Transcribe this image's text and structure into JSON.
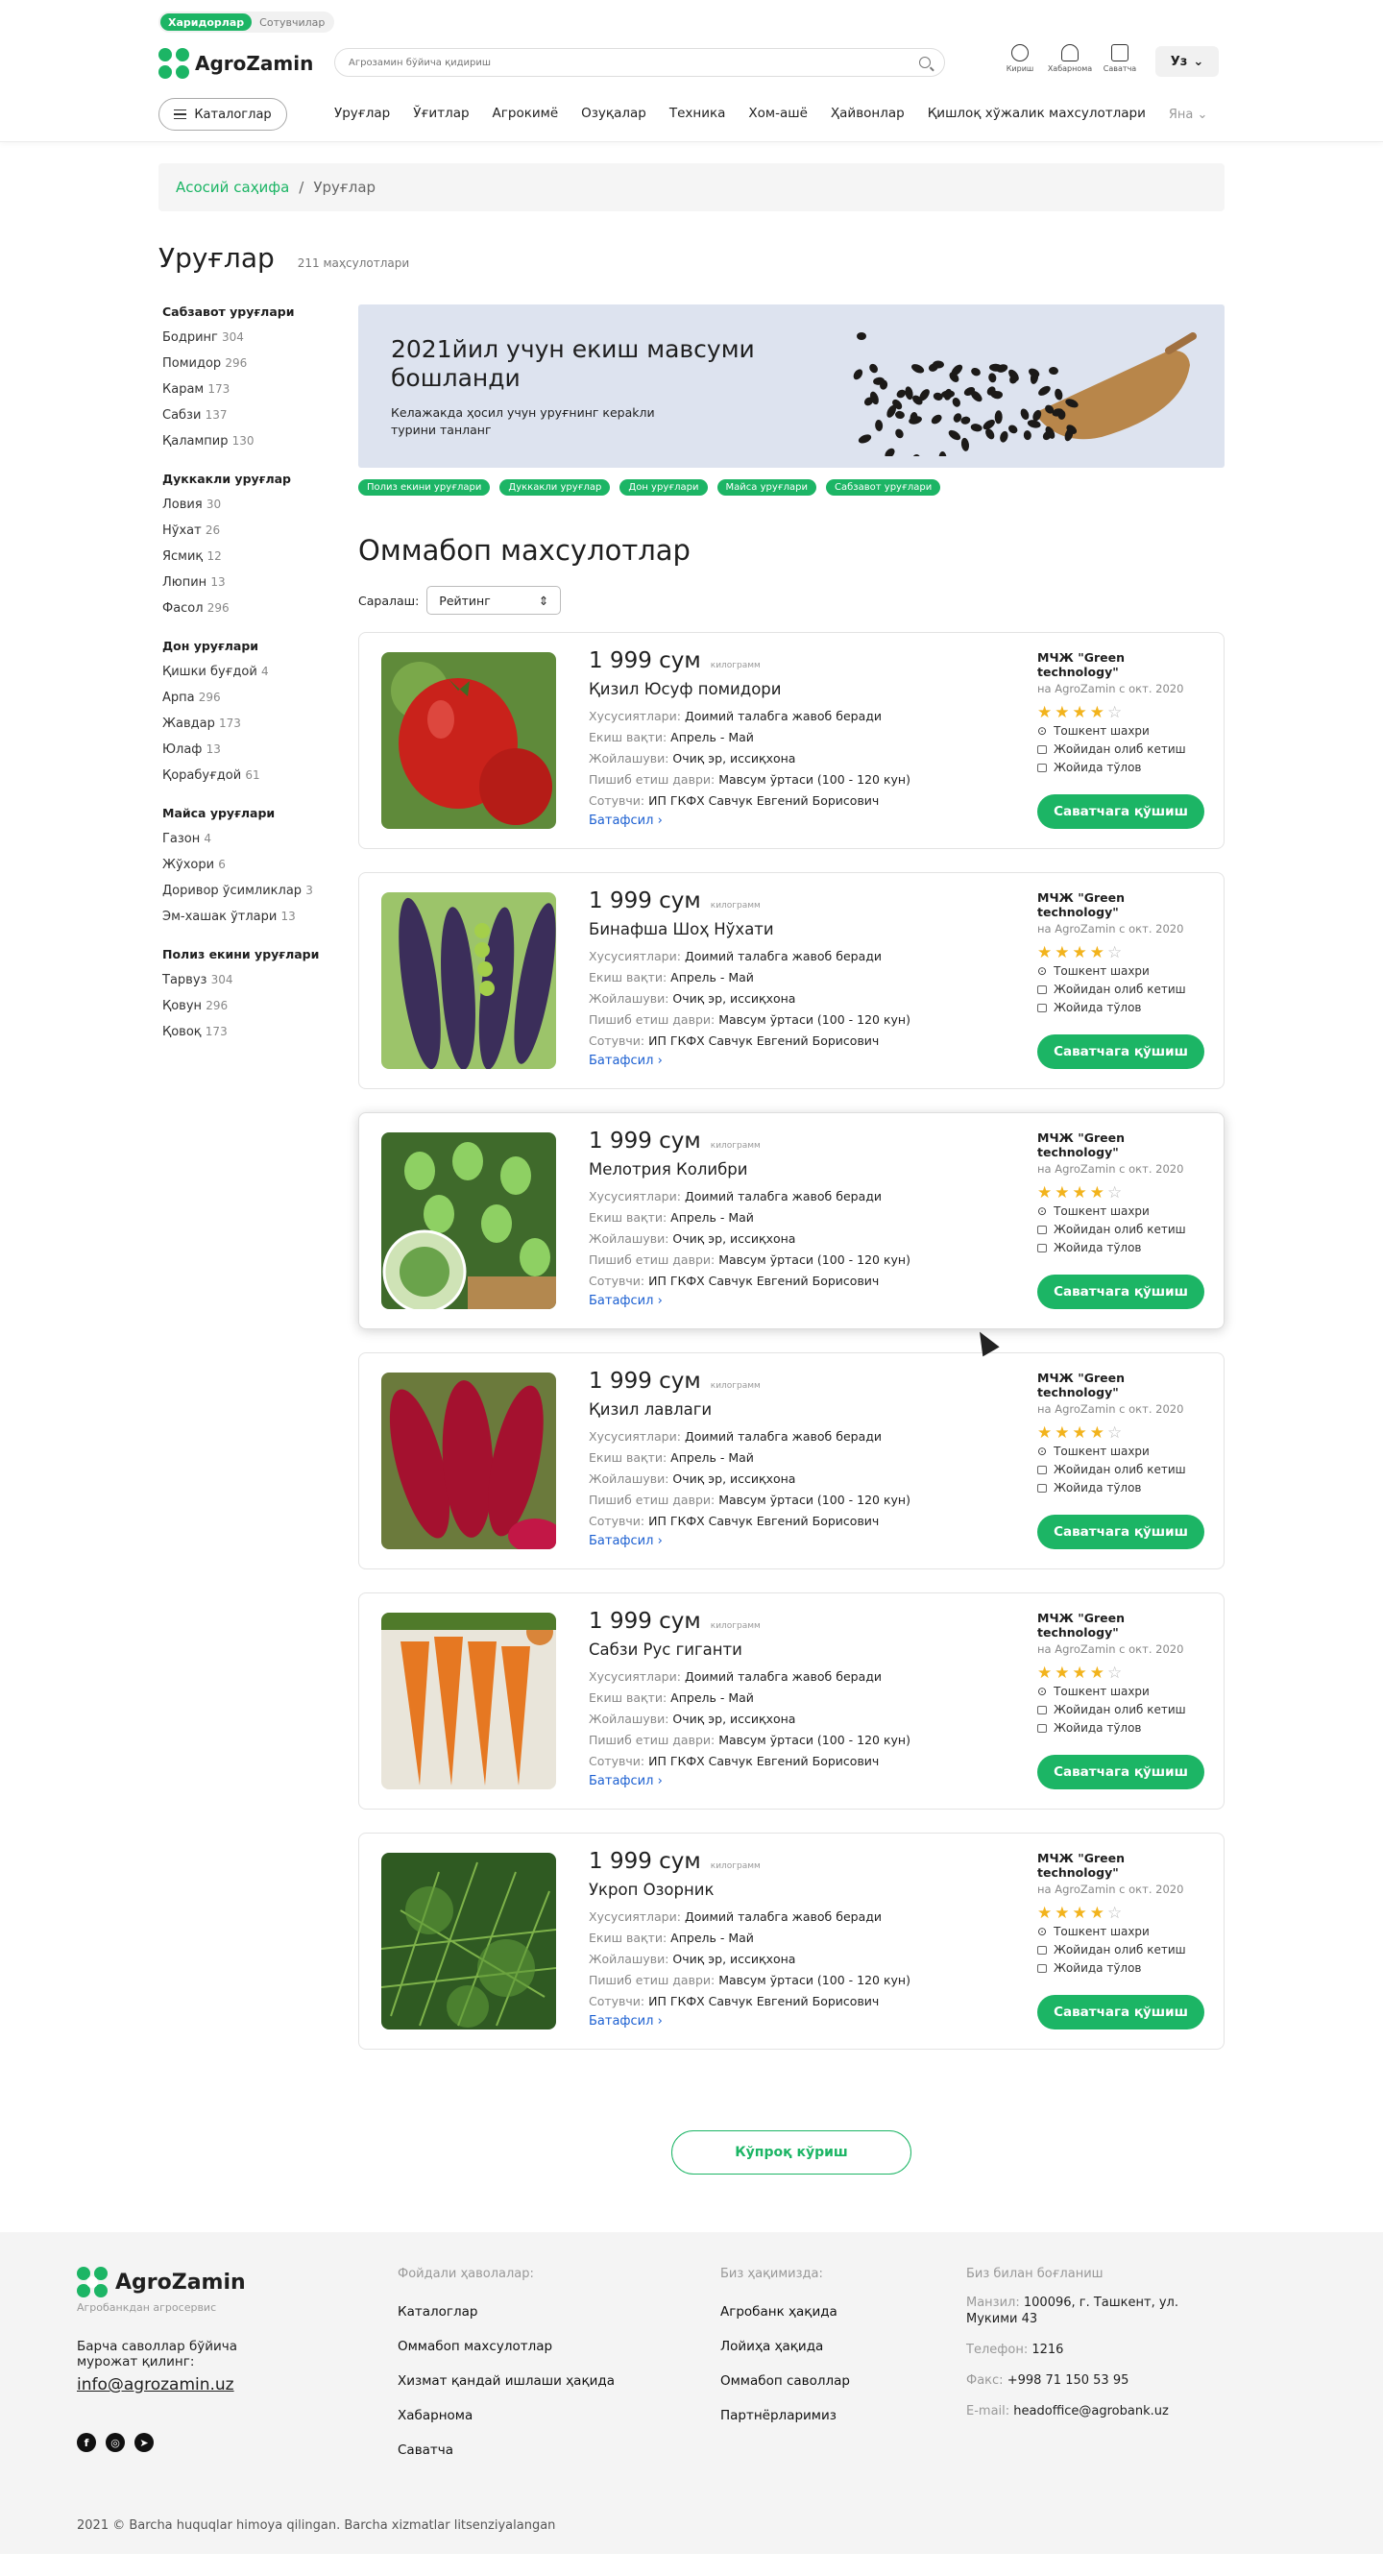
{
  "header": {
    "role_buyers": "Харидорлар",
    "role_sellers": "Сотувчилар",
    "logo": "AgroZamin",
    "search_placeholder": "Агрозамин бўйича қидириш",
    "icons": [
      {
        "name": "login",
        "label": "Кириш"
      },
      {
        "name": "notifications",
        "label": "Хабарнома"
      },
      {
        "name": "cart",
        "label": "Саватча"
      }
    ],
    "lang": "Уз",
    "catalog_btn": "Каталоглар",
    "nav": [
      "Уруғлар",
      "Ўғитлар",
      "Агрокимё",
      "Озуқалар",
      "Техника",
      "Хом-ашё",
      "Ҳайвонлар",
      "Қишлоқ хўжалик махсулотлари"
    ],
    "nav_more": "Яна"
  },
  "breadcrumb": {
    "home": "Асосий саҳифа",
    "sep": "/",
    "current": "Уруғлар"
  },
  "page": {
    "title": "Уруғлар",
    "count": "211 маҳсулотлари"
  },
  "sidebar": [
    {
      "title": "Сабзавот уруғлари",
      "items": [
        [
          "Бодринг",
          "304"
        ],
        [
          "Помидор",
          "296"
        ],
        [
          "Карам",
          "173"
        ],
        [
          "Сабзи",
          "137"
        ],
        [
          "Қалампир",
          "130"
        ]
      ]
    },
    {
      "title": "Дуккакли уруғлар",
      "items": [
        [
          "Ловия",
          "30"
        ],
        [
          "Нўхат",
          "26"
        ],
        [
          "Ясмиқ",
          "12"
        ],
        [
          "Люпин",
          "13"
        ],
        [
          "Фасол",
          "296"
        ]
      ]
    },
    {
      "title": "Дон уруғлари",
      "items": [
        [
          "Қишки буғдой",
          "4"
        ],
        [
          "Арпа",
          "296"
        ],
        [
          "Жавдар",
          "173"
        ],
        [
          "Юлаф",
          "13"
        ],
        [
          "Қорабуғдой",
          "61"
        ]
      ]
    },
    {
      "title": "Майса уруғлари",
      "items": [
        [
          "Газон",
          "4"
        ],
        [
          "Жўхори",
          "6"
        ],
        [
          "Доривор ўсимликлар",
          "3"
        ],
        [
          "Эм-хашак ўтлари",
          "13"
        ]
      ]
    },
    {
      "title": "Полиз екини уруғлари",
      "items": [
        [
          "Тарвуз",
          "304"
        ],
        [
          "Қовун",
          "296"
        ],
        [
          "Қовоқ",
          "173"
        ]
      ]
    }
  ],
  "banner": {
    "title": "2021йил учун екиш мавсуми бошланди",
    "text": "Келажакда ҳосил учун уруғнинг кераkли турини танланг"
  },
  "chips": [
    "Полиз екини уруғлари",
    "Дуккакли уруғлар",
    "Дон уруғлари",
    "Майса уруғлари",
    "Сабзавот уруғлари"
  ],
  "section_title": "Оммабоп махсулотлар",
  "sort": {
    "label": "Саралаш:",
    "value": "Рейтинг"
  },
  "labels": {
    "unit": "килограмм",
    "features": "Хусусиятлари:",
    "sowing": "Екиш вақти:",
    "location": "Жойлашуви:",
    "ripening": "Пишиб етиш даври:",
    "seller": "Сотувчи:",
    "details": "Батафсил",
    "add_cart": "Саватчага қўшиш",
    "since": "на AgroZamin с окт. 2020",
    "city": "Тошкент шахри",
    "delivery": "Жойидан олиб кетиш",
    "payment": "Жойида тўлов"
  },
  "products": [
    {
      "price": "1 999 сум",
      "name": "Қизил Юсуф помидори",
      "features": "Доимий талабга жавоб беради",
      "sowing": "Апрель - Май",
      "location": "Очиқ эр, иссиқхона",
      "ripening": "Мавсум ўртаси (100 - 120 кун)",
      "seller": "ИП ГКФХ Савчук Евгений Борисович",
      "company": "МЧЖ \"Green technology\"",
      "rating": 4,
      "img": "tomato"
    },
    {
      "price": "1 999 сум",
      "name": "Бинафша Шоҳ Нўхати",
      "features": "Доимий талабга жавоб беради",
      "sowing": "Апрель - Май",
      "location": "Очиқ эр, иссиқхона",
      "ripening": "Мавсум ўртаси (100 - 120 кун)",
      "seller": "ИП ГКФХ Савчук Евгений Борисович",
      "company": "МЧЖ \"Green technology\"",
      "rating": 4,
      "img": "peas"
    },
    {
      "price": "1 999 сум",
      "name": "Мелотрия Колибри",
      "features": "Доимий талабга жавоб беради",
      "sowing": "Апрель - Май",
      "location": "Очиқ эр, иссиқхона",
      "ripening": "Мавсум ўртаси (100 - 120 кун)",
      "seller": "ИП ГКФХ Савчук Евгений Борисович",
      "company": "МЧЖ \"Green technology\"",
      "rating": 4,
      "img": "melothria"
    },
    {
      "price": "1 999 сум",
      "name": "Қизил лавлаги",
      "features": "Доимий талабга жавоб беради",
      "sowing": "Апрель - Май",
      "location": "Очиқ эр, иссиқхона",
      "ripening": "Мавсум ўртаси (100 - 120 кун)",
      "seller": "ИП ГКФХ Савчук Евгений Борисович",
      "company": "МЧЖ \"Green technology\"",
      "rating": 4,
      "img": "beet"
    },
    {
      "price": "1 999 сум",
      "name": "Сабзи Рус гиганти",
      "features": "Доимий талабга жавоб беради",
      "sowing": "Апрель - Май",
      "location": "Очиқ эр, иссиқхона",
      "ripening": "Мавсум ўртаси (100 - 120 кун)",
      "seller": "ИП ГКФХ Савчук Евгений Борисович",
      "company": "МЧЖ \"Green technology\"",
      "rating": 4,
      "img": "carrot"
    },
    {
      "price": "1 999 сум",
      "name": "Укроп Озорник",
      "features": "Доимий талабга жавоб беради",
      "sowing": "Апрель - Май",
      "location": "Очиқ эр, иссиқхона",
      "ripening": "Мавсум ўртаси (100 - 120 кун)",
      "seller": "ИП ГКФХ Савчук Евгений Борисович",
      "company": "МЧЖ \"Green technology\"",
      "rating": 4,
      "img": "dill"
    }
  ],
  "show_more": "Кўпроқ кўриш",
  "footer": {
    "logo": "AgroZamin",
    "sub": "Агробанкдан агросервис",
    "question": "Барча саволлар бўйича мурожат қилинг:",
    "email": "info@agrozamin.uz",
    "useful_title": "Фойдали ҳаволалар:",
    "useful": [
      "Каталоглар",
      "Оммабоп махсулотлар",
      "Хизмат қандай ишлаши ҳақида",
      "Хабарнома",
      "Саватча"
    ],
    "about_title": "Биз ҳақимизда:",
    "about": [
      "Агробанк ҳақида",
      "Лойиҳа ҳақида",
      "Оммабоп саволлар",
      "Партнёрларимиз"
    ],
    "contact_title": "Биз билан боғланиш",
    "address_label": "Манзил:",
    "address": "100096, г. Ташкент, ул. Мукими 43",
    "phone_label": "Телефон:",
    "phone": "1216",
    "fax_label": "Факс:",
    "fax": "+998 71 150 53 95",
    "email_label": "E-mail:",
    "email2": "headoffice@agrobank.uz",
    "copyright": "2021 © Barcha huquqlar himoya qilingan. Barcha xizmatlar litsenziyalangan"
  },
  "colors": {
    "accent": "#1cb565",
    "link": "#1b5fd1",
    "star": "#f2b31c"
  }
}
